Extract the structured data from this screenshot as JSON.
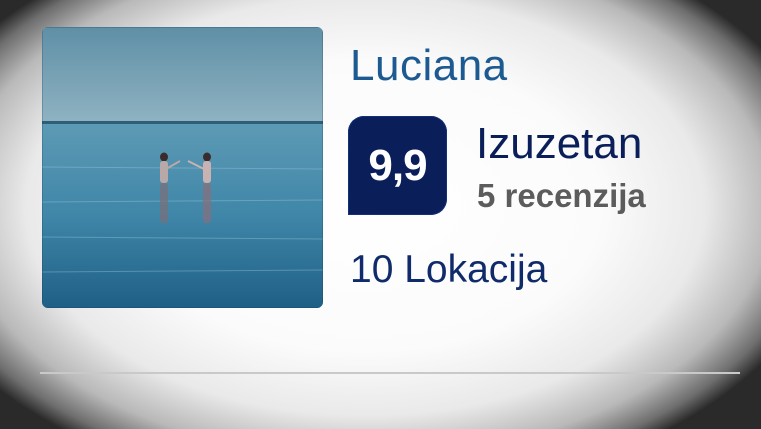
{
  "host": {
    "name": "Luciana",
    "photo_icon": "profile-photo-sea-image"
  },
  "rating": {
    "score": "9,9",
    "label": "Izuzetan",
    "reviews": "5 recenzija"
  },
  "locations": {
    "label": "10 Lokacija"
  },
  "colors": {
    "name_blue": "#1d5a92",
    "badge_navy": "#0a1f5a",
    "text_navy": "#0f2b6b",
    "review_gray": "#5c5c5c",
    "divider_gray": "#c9c9c9"
  }
}
